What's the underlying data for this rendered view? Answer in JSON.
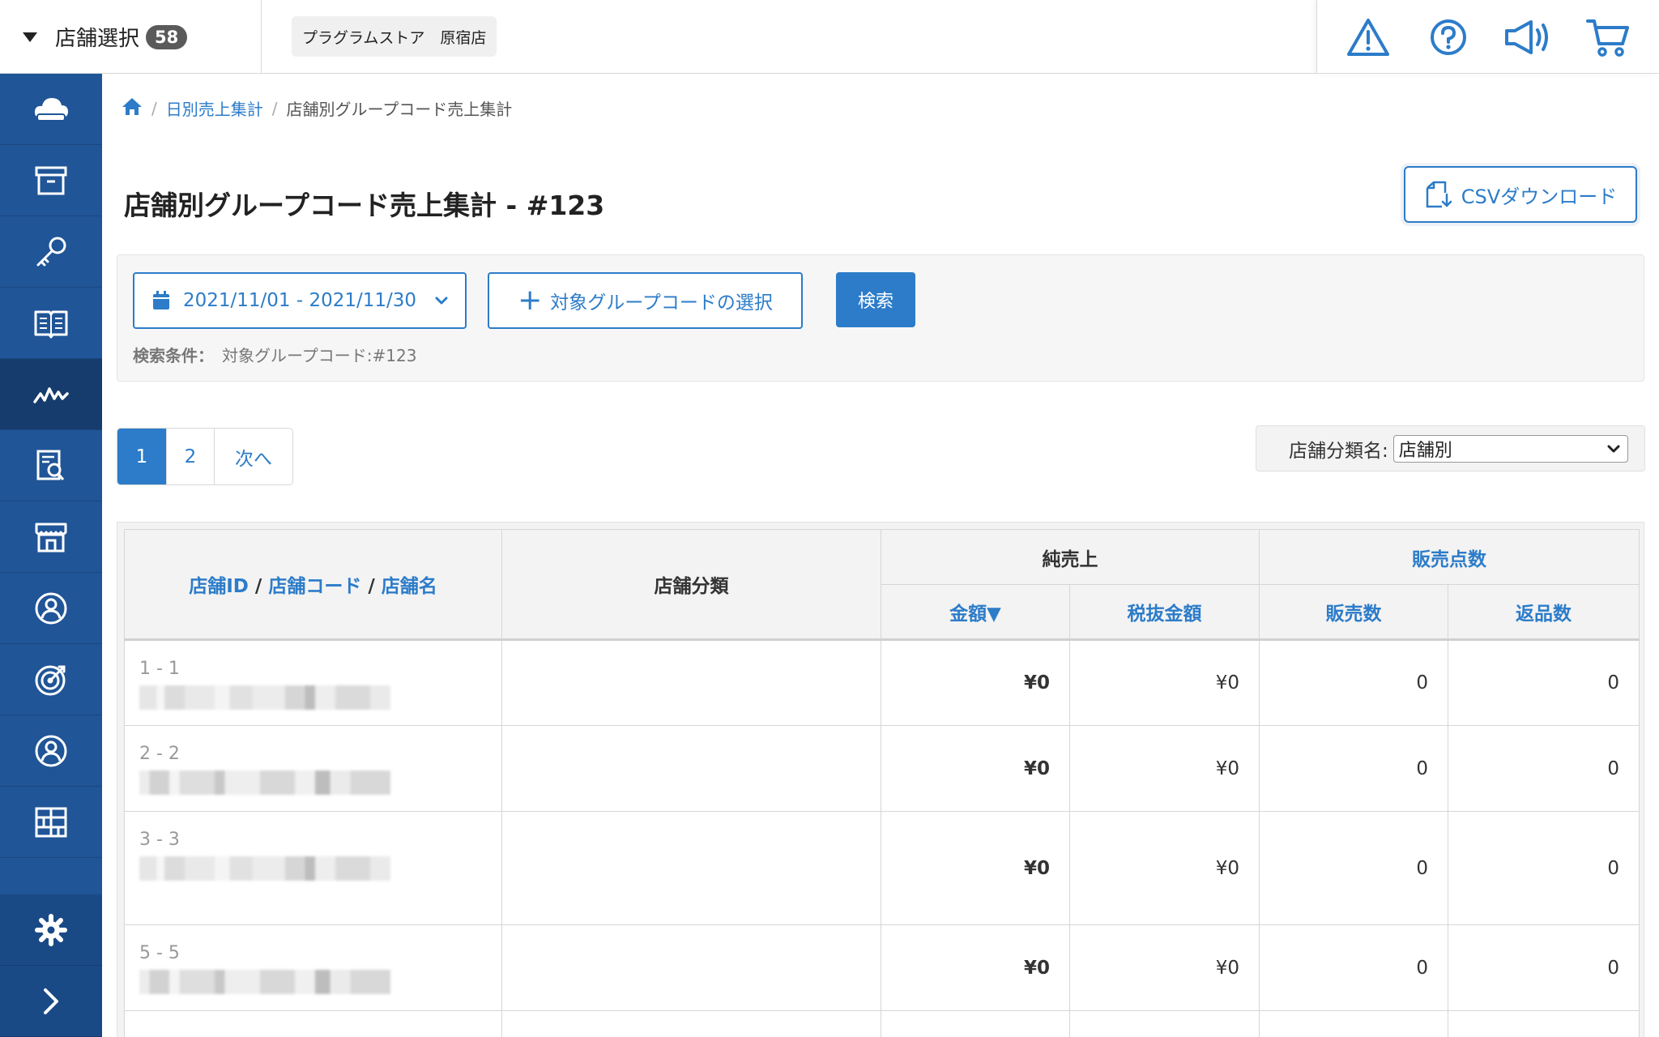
{
  "topbar": {
    "store_select_label": "店舗選択",
    "store_count": "58",
    "current_store": "プラグラムストア　原宿店",
    "icons": [
      "warning-icon",
      "help-icon",
      "announcement-icon",
      "cart-icon"
    ]
  },
  "sidebar": {
    "items": [
      "cloud-icon",
      "archive-icon",
      "key-icon",
      "book-icon",
      "sales-chart-icon",
      "report-search-icon",
      "store-icon",
      "customer-icon",
      "target-icon",
      "staff-icon",
      "grid-icon"
    ],
    "active_item": "sales-chart-icon",
    "bottom_items": [
      "settings-icon",
      "expand-icon"
    ]
  },
  "breadcrumb": {
    "home_icon": "home-icon",
    "link": "日別売上集計",
    "current": "店舗別グループコード売上集計"
  },
  "page": {
    "title": "店舗別グループコード売上集計 - #123",
    "csv_button": "CSVダウンロード"
  },
  "search": {
    "date_range": "2021/11/01 - 2021/11/30",
    "group_code_button": "対象グループコードの選択",
    "search_button": "検索",
    "condition_label": "検索条件：",
    "condition_value": "対象グループコード:#123"
  },
  "pagination": {
    "page1": "1",
    "page2": "2",
    "next": "次へ"
  },
  "filter": {
    "label": "店舗分類名:",
    "selected": "店舗別"
  },
  "table": {
    "headers": {
      "store_id": "店舗ID",
      "store_code": "店舗コード",
      "store_name": "店舗名",
      "slash": "/",
      "store_class": "店舗分類",
      "net_sales": "純売上",
      "amount": "金額▼",
      "amount_ex_tax": "税抜金額",
      "units_sold": "販売点数",
      "sold": "販売数",
      "returns": "返品数"
    },
    "rows": [
      {
        "id": "1 - 1",
        "amount": "¥0",
        "amount_ex_tax": "¥0",
        "sold": "0",
        "returns": "0"
      },
      {
        "id": "2 - 2",
        "amount": "¥0",
        "amount_ex_tax": "¥0",
        "sold": "0",
        "returns": "0"
      },
      {
        "id": "3 - 3",
        "amount": "¥0",
        "amount_ex_tax": "¥0",
        "sold": "0",
        "returns": "0"
      },
      {
        "id": "5 - 5",
        "amount": "¥0",
        "amount_ex_tax": "¥0",
        "sold": "0",
        "returns": "0"
      }
    ]
  },
  "colors": {
    "sidebar": "#205597",
    "sidebar_active": "#163c6d",
    "accent": "#2c7cc9"
  }
}
